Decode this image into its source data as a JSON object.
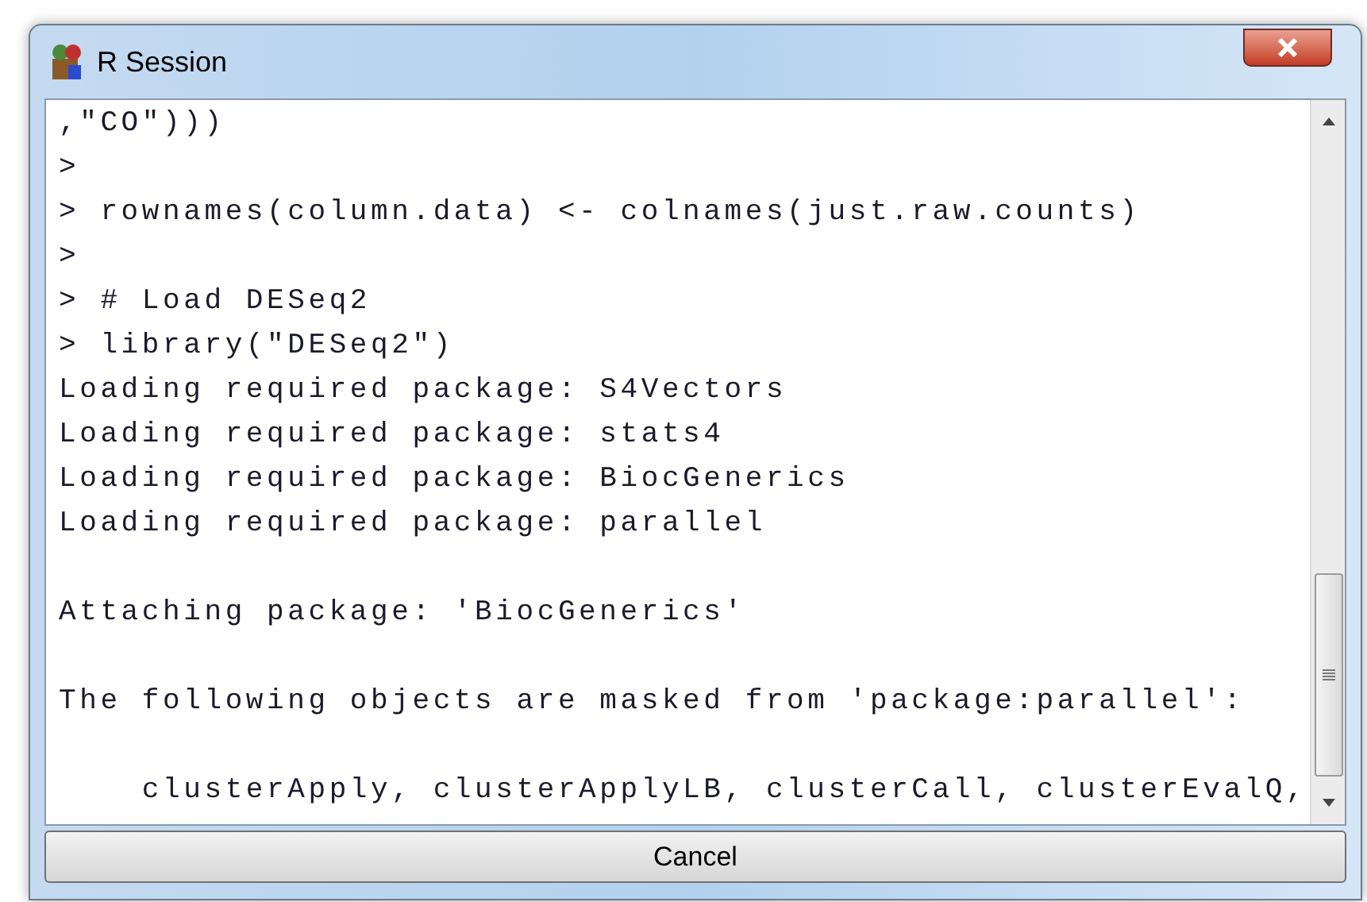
{
  "window": {
    "title": "R Session"
  },
  "console": {
    "blocks": [
      [
        ",\"CO\")))",
        ">",
        "> rownames(column.data) <- colnames(just.raw.counts)",
        ">",
        "> # Load DESeq2",
        "> library(\"DESeq2\")",
        "Loading required package: S4Vectors",
        "Loading required package: stats4",
        "Loading required package: BiocGenerics",
        "Loading required package: parallel"
      ],
      [
        "Attaching package: 'BiocGenerics'"
      ],
      [
        "The following objects are masked from 'package:parallel':"
      ],
      [
        "    clusterApply, clusterApplyLB, clusterCall, clusterEvalQ,"
      ]
    ]
  },
  "buttons": [
    {
      "label": "Cancel"
    }
  ]
}
